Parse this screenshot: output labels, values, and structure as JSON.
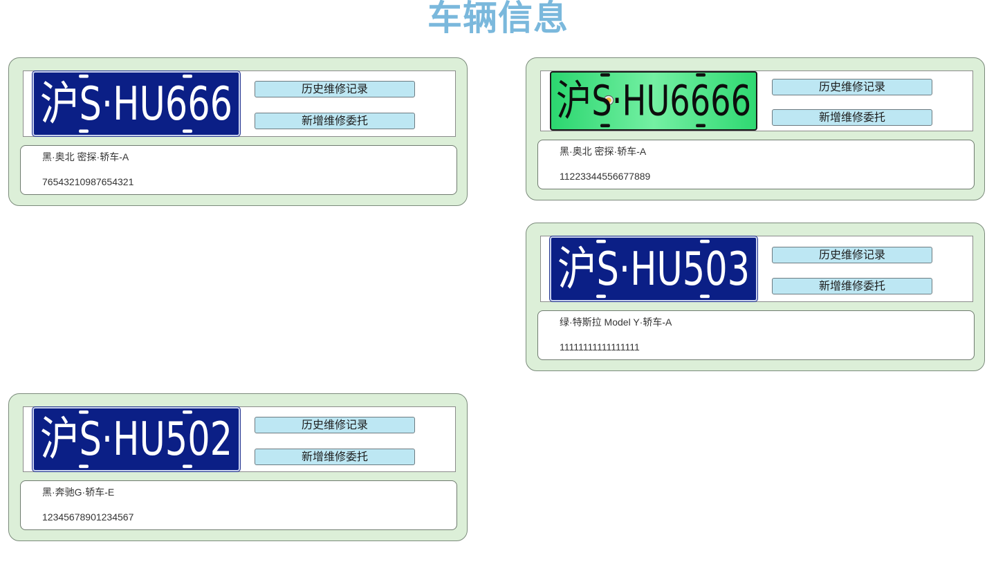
{
  "page": {
    "title": "车辆信息"
  },
  "vehicles": [
    {
      "plate_number": "沪S·HU666",
      "plate_color": "blue",
      "history_button": "历史维修记录",
      "new_button": "新增维修委托",
      "description": "黑·奥北 密探·轿车-A",
      "vin": "76543210987654321"
    },
    {
      "plate_number": "沪S·HU6666",
      "plate_color": "green",
      "history_button": "历史维修记录",
      "new_button": "新增维修委托",
      "description": "黑·奥北 密探·轿车-A",
      "vin": "11223344556677889"
    },
    {
      "plate_number": "沪S·HU503",
      "plate_color": "blue",
      "history_button": "历史维修记录",
      "new_button": "新增维修委托",
      "description": "绿·特斯拉 Model Y·轿车-A",
      "vin": "11111111111111111"
    },
    {
      "plate_number": "沪S·HU502",
      "plate_color": "blue",
      "history_button": "历史维修记录",
      "new_button": "新增维修委托",
      "description": "黑·奔驰G·轿车-E",
      "vin": "12345678901234567"
    }
  ],
  "colors": {
    "title": "#7ab8dc",
    "card_background": "#dcefd8",
    "button_background": "#bde7f3",
    "plate_blue": "#0b1f86",
    "plate_green": "#2bd66f"
  }
}
